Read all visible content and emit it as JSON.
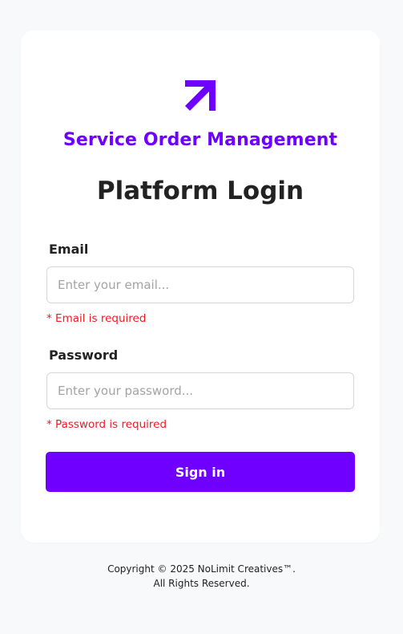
{
  "app": {
    "brand_title": "Service Order Management",
    "page_heading": "Platform Login",
    "logo_icon": "arrow-up-right-icon"
  },
  "form": {
    "email": {
      "label": "Email",
      "placeholder": "Enter your email...",
      "value": "",
      "error": "* Email is required"
    },
    "password": {
      "label": "Password",
      "placeholder": "Enter your password...",
      "value": "",
      "error": "* Password is required"
    },
    "submit_label": "Sign in"
  },
  "footer": {
    "line1": "Copyright © 2025 NoLimit Creatives™.",
    "line2": "All Rights Reserved."
  },
  "colors": {
    "accent": "#6f00ff",
    "error": "#ec1c24",
    "background": "#f8f9fb"
  }
}
